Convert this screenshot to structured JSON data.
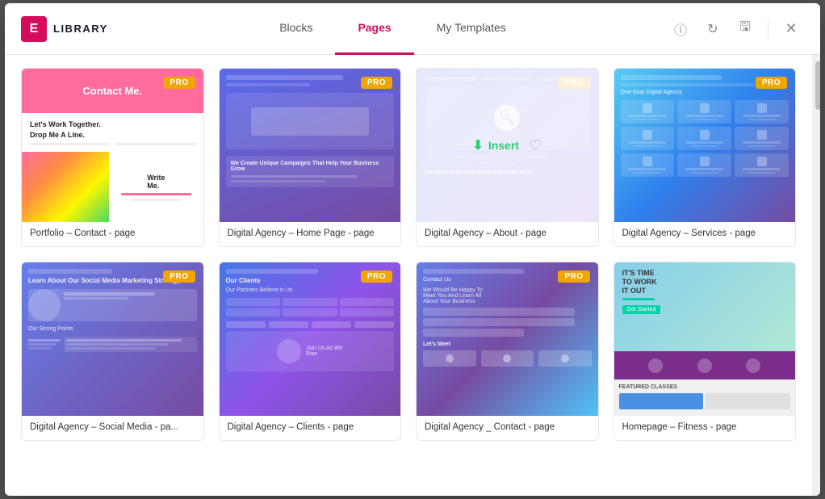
{
  "modal": {
    "title": "LIBRARY",
    "logo_letter": "E"
  },
  "tabs": [
    {
      "id": "blocks",
      "label": "Blocks",
      "active": false
    },
    {
      "id": "pages",
      "label": "Pages",
      "active": true
    },
    {
      "id": "my-templates",
      "label": "My Templates",
      "active": false
    }
  ],
  "actions": {
    "info_tooltip": "ℹ",
    "refresh": "↻",
    "save": "💾",
    "close": "✕"
  },
  "cards": [
    {
      "id": "card-1",
      "label": "Portfolio – Contact - page",
      "pro": true,
      "highlighted": false,
      "thumb_type": "portfolio"
    },
    {
      "id": "card-2",
      "label": "Digital Agency – Home Page - page",
      "pro": true,
      "highlighted": false,
      "thumb_type": "digital-home"
    },
    {
      "id": "card-3",
      "label": "Digital Agency – About - page",
      "pro": true,
      "highlighted": true,
      "thumb_type": "digital-about",
      "insert_label": "Insert"
    },
    {
      "id": "card-4",
      "label": "Digital Agency – Services - page",
      "pro": true,
      "highlighted": false,
      "thumb_type": "digital-services"
    },
    {
      "id": "card-5",
      "label": "Digital Agency – Social Media - pa...",
      "pro": true,
      "highlighted": false,
      "thumb_type": "social"
    },
    {
      "id": "card-6",
      "label": "Digital Agency – Clients - page",
      "pro": true,
      "highlighted": false,
      "thumb_type": "clients"
    },
    {
      "id": "card-7",
      "label": "Digital Agency _ Contact - page",
      "pro": true,
      "highlighted": false,
      "thumb_type": "contact"
    },
    {
      "id": "card-8",
      "label": "Homepage – Fitness - page",
      "pro": false,
      "highlighted": false,
      "thumb_type": "fitness"
    }
  ],
  "insert_label": "Insert",
  "pro_label": "PRO"
}
